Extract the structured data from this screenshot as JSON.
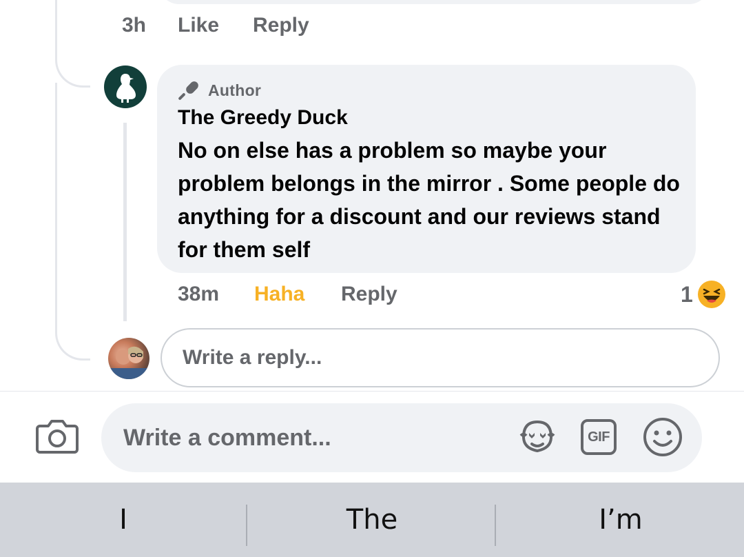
{
  "previous_comment": {
    "time": "3h",
    "like_label": "Like",
    "reply_label": "Reply"
  },
  "author_comment": {
    "badge_label": "Author",
    "name": "The Greedy Duck",
    "text": "No on else has a problem so maybe your problem belongs in the mirror . Some people do anything for a discount and our reviews stand for them self",
    "time": "38m",
    "reaction_label": "Haha",
    "reply_label": "Reply",
    "reaction_count": "1",
    "reaction_icon": "haha-emoji-icon",
    "colors": {
      "haha": "#f7b125",
      "meta": "#65676b",
      "bubble": "#f0f2f5"
    }
  },
  "reply_input": {
    "placeholder": "Write a reply..."
  },
  "composer": {
    "placeholder": "Write a comment...",
    "icons": [
      "camera-icon",
      "avatar-sticker-icon",
      "gif-icon",
      "emoji-icon"
    ],
    "gif_label": "GIF"
  },
  "keyboard": {
    "suggestions": [
      "I",
      "The",
      "I’m"
    ]
  }
}
